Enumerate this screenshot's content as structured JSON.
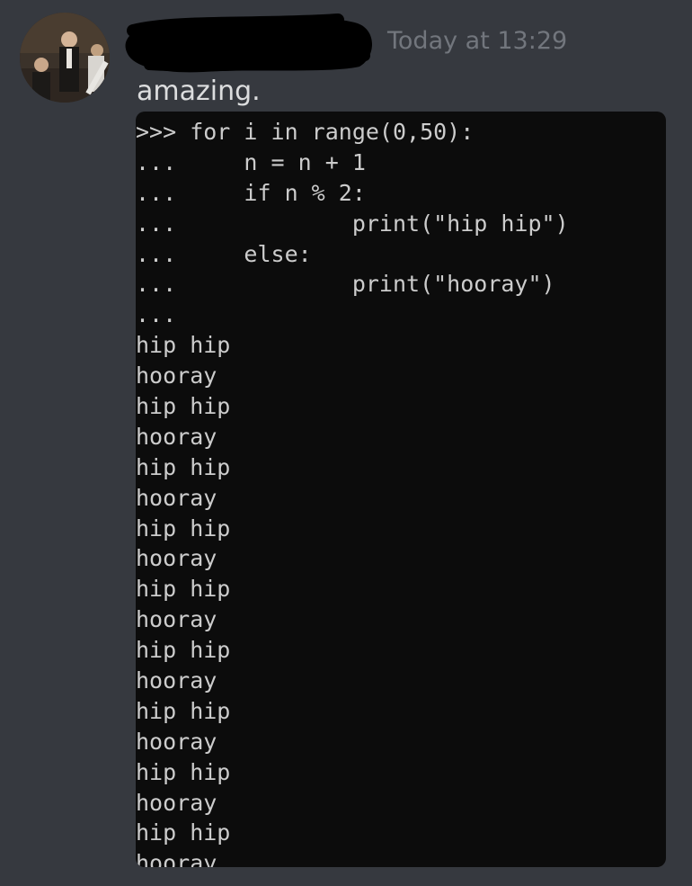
{
  "message": {
    "timestamp": "Today at 13:29",
    "text": "amazing."
  },
  "console": {
    "lines": [
      ">>> for i in range(0,50):",
      "...     n = n + 1",
      "...     if n % 2:",
      "...             print(\"hip hip\")",
      "...     else:",
      "...             print(\"hooray\")",
      "...",
      "hip hip",
      "hooray",
      "hip hip",
      "hooray",
      "hip hip",
      "hooray",
      "hip hip",
      "hooray",
      "hip hip",
      "hooray",
      "hip hip",
      "hooray",
      "hip hip",
      "hooray",
      "hip hip",
      "hooray",
      "hip hip",
      "hooray"
    ]
  },
  "colors": {
    "background": "#36393f",
    "message_text": "#dcddde",
    "timestamp": "#72767d",
    "console_background": "#0c0c0c",
    "console_text": "#cccccc",
    "redaction": "#000000"
  },
  "icons": {
    "avatar": "user-avatar-photo",
    "username": "redaction-scribble"
  }
}
